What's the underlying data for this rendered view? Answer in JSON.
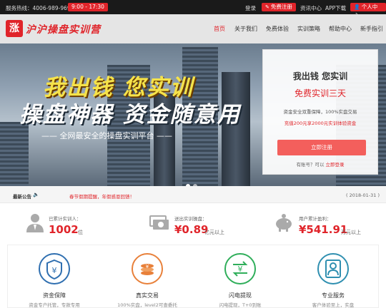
{
  "topbar": {
    "hotline": "服务热线：4006-989-969",
    "hours": "9:00 - 17:30",
    "login": "登录",
    "register": "免费注册",
    "info": "资讯中心",
    "app": "APP下载",
    "personal": "个人中心"
  },
  "nav": {
    "logo_mark": "涨",
    "logo_text": "沪沪操盘实训营",
    "items": [
      "首页",
      "关于我们",
      "免费体验",
      "实训策略",
      "帮助中心",
      "新手指引"
    ]
  },
  "banner": {
    "slogan1": "我出钱 您实训",
    "slogan2": "操盘神器 资金随意用",
    "slogan3": "—— 全网最安全的操盘实训平台 ——"
  },
  "card": {
    "title": "我出钱 您实训",
    "free": "免费实训三天",
    "safe": "资金安全双重保障，100%实盘交易",
    "bonus": "充值200元享2000元实训体验资金",
    "button": "立即注册",
    "login_prefix": "有账号？可以",
    "login_link": "立即登录"
  },
  "notice": {
    "label": "最新公告",
    "text": "春节假期提醒，年假感恩回馈！",
    "date": "( 2018-01-31 )"
  },
  "stats": [
    {
      "icon": "user-icon",
      "label": "已累计实训人：",
      "value": "1002",
      "unit": "位"
    },
    {
      "icon": "money-icon",
      "label": "送出实训操盘：",
      "value": "¥0.89",
      "unit": "亿元以上"
    },
    {
      "icon": "piggy-bank-icon",
      "label": "用户累计盈利：",
      "value": "¥541.91",
      "unit": "万元以上"
    }
  ],
  "features": [
    {
      "icon": "shield-yuan-icon",
      "title": "资金保障",
      "sub": "资金专户托管，专款专用",
      "color": "#2f6fb0"
    },
    {
      "icon": "coin-chart-icon",
      "title": "真实交易",
      "sub": "100%实盘，level2可查委托",
      "color": "#e8803a"
    },
    {
      "icon": "yuan-arrows-icon",
      "title": "闪电提现",
      "sub": "闪电提现，T+0到账",
      "color": "#2fae5a"
    },
    {
      "icon": "person-card-icon",
      "title": "专业服务",
      "sub": "客户体验至上，实盘",
      "color": "#2f8fb0"
    }
  ]
}
